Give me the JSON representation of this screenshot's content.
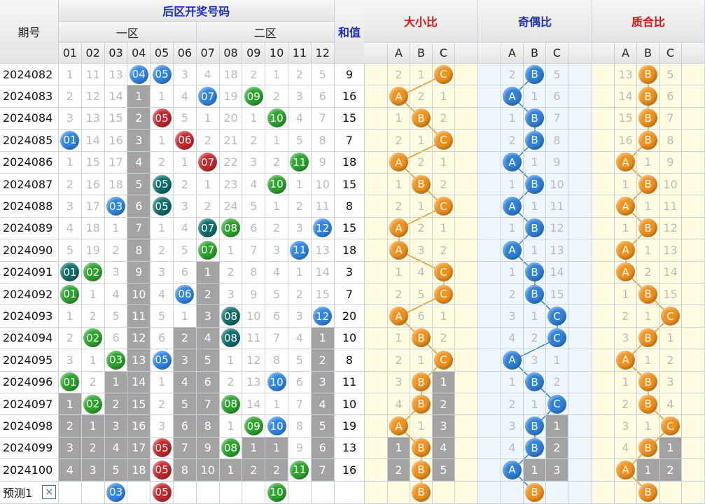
{
  "headers": {
    "issue": "期号",
    "back_area": "后区开奖号码",
    "zone1": "一区",
    "zone2": "二区",
    "sum": "和值",
    "size_ratio": "大小比",
    "parity_ratio": "奇偶比",
    "prime_ratio": "质合比",
    "numbers": [
      "01",
      "02",
      "03",
      "04",
      "05",
      "06",
      "07",
      "08",
      "09",
      "10",
      "11",
      "12"
    ],
    "abc": [
      "A",
      "B",
      "C"
    ]
  },
  "colors": {
    "blue": "#2e86e8",
    "red": "#c9262c",
    "green": "#2aa52a",
    "teal": "#0d6e6c",
    "orange": "#f2921c",
    "gray_fill": "#a3a3a3"
  },
  "rows": [
    {
      "issue": "2024082",
      "cells": [
        "1",
        "11",
        "13",
        "04",
        "05",
        "3",
        "4",
        "18",
        "2",
        "1",
        "2",
        "5"
      ],
      "sum": "9",
      "dx": [
        "2",
        "1",
        "C"
      ],
      "jo": [
        "2",
        "B",
        "5"
      ],
      "zh": [
        "13",
        "B",
        "5"
      ]
    },
    {
      "issue": "2024083",
      "cells": [
        "2",
        "12",
        "14",
        "1",
        "1",
        "4",
        "07",
        "19",
        "09",
        "2",
        "3",
        "6"
      ],
      "sum": "16",
      "dx": [
        "A",
        "2",
        "1"
      ],
      "jo": [
        "A",
        "1",
        "6"
      ],
      "zh": [
        "14",
        "B",
        "6"
      ]
    },
    {
      "issue": "2024084",
      "cells": [
        "3",
        "13",
        "15",
        "2",
        "05",
        "5",
        "1",
        "20",
        "1",
        "10",
        "4",
        "7"
      ],
      "sum": "15",
      "dx": [
        "1",
        "B",
        "2"
      ],
      "jo": [
        "1",
        "B",
        "7"
      ],
      "zh": [
        "15",
        "B",
        "7"
      ]
    },
    {
      "issue": "2024085",
      "cells": [
        "01",
        "14",
        "16",
        "3",
        "1",
        "06",
        "2",
        "21",
        "2",
        "1",
        "5",
        "8"
      ],
      "sum": "7",
      "dx": [
        "2",
        "1",
        "C"
      ],
      "jo": [
        "2",
        "B",
        "8"
      ],
      "zh": [
        "16",
        "B",
        "8"
      ]
    },
    {
      "issue": "2024086",
      "cells": [
        "1",
        "15",
        "17",
        "4",
        "2",
        "1",
        "07",
        "22",
        "3",
        "2",
        "11",
        "9"
      ],
      "sum": "18",
      "dx": [
        "A",
        "2",
        "1"
      ],
      "jo": [
        "A",
        "1",
        "9"
      ],
      "zh": [
        "A",
        "1",
        "9"
      ]
    },
    {
      "issue": "2024087",
      "cells": [
        "2",
        "16",
        "18",
        "5",
        "05",
        "2",
        "1",
        "23",
        "4",
        "10",
        "1",
        "10"
      ],
      "sum": "15",
      "dx": [
        "1",
        "B",
        "2"
      ],
      "jo": [
        "1",
        "B",
        "10"
      ],
      "zh": [
        "1",
        "B",
        "10"
      ]
    },
    {
      "issue": "2024088",
      "cells": [
        "3",
        "17",
        "03",
        "6",
        "05",
        "3",
        "2",
        "24",
        "5",
        "1",
        "2",
        "11"
      ],
      "sum": "8",
      "dx": [
        "2",
        "1",
        "C"
      ],
      "jo": [
        "A",
        "1",
        "11"
      ],
      "zh": [
        "A",
        "1",
        "11"
      ]
    },
    {
      "issue": "2024089",
      "cells": [
        "4",
        "18",
        "1",
        "7",
        "1",
        "4",
        "07",
        "08",
        "6",
        "2",
        "3",
        "12"
      ],
      "sum": "15",
      "dx": [
        "A",
        "2",
        "1"
      ],
      "jo": [
        "1",
        "B",
        "12"
      ],
      "zh": [
        "1",
        "B",
        "12"
      ]
    },
    {
      "issue": "2024090",
      "cells": [
        "5",
        "19",
        "2",
        "8",
        "2",
        "5",
        "07",
        "1",
        "7",
        "3",
        "11",
        "13"
      ],
      "sum": "18",
      "dx": [
        "A",
        "3",
        "2"
      ],
      "jo": [
        "A",
        "1",
        "13"
      ],
      "zh": [
        "A",
        "1",
        "13"
      ]
    },
    {
      "issue": "2024091",
      "cells": [
        "01",
        "02",
        "3",
        "9",
        "3",
        "6",
        "1",
        "2",
        "8",
        "4",
        "1",
        "14"
      ],
      "sum": "3",
      "dx": [
        "1",
        "4",
        "C"
      ],
      "jo": [
        "1",
        "B",
        "14"
      ],
      "zh": [
        "A",
        "2",
        "14"
      ]
    },
    {
      "issue": "2024092",
      "cells": [
        "01",
        "1",
        "4",
        "10",
        "4",
        "06",
        "2",
        "3",
        "9",
        "5",
        "2",
        "15"
      ],
      "sum": "7",
      "dx": [
        "2",
        "5",
        "C"
      ],
      "jo": [
        "2",
        "B",
        "15"
      ],
      "zh": [
        "1",
        "B",
        "15"
      ]
    },
    {
      "issue": "2024093",
      "cells": [
        "1",
        "2",
        "5",
        "11",
        "5",
        "1",
        "3",
        "08",
        "10",
        "6",
        "3",
        "12"
      ],
      "sum": "20",
      "dx": [
        "A",
        "6",
        "1"
      ],
      "jo": [
        "3",
        "1",
        "C"
      ],
      "zh": [
        "2",
        "1",
        "C"
      ]
    },
    {
      "issue": "2024094",
      "cells": [
        "2",
        "02",
        "6",
        "12",
        "6",
        "2",
        "4",
        "08",
        "11",
        "7",
        "4",
        "1"
      ],
      "sum": "10",
      "dx": [
        "1",
        "B",
        "2"
      ],
      "jo": [
        "4",
        "2",
        "C"
      ],
      "zh": [
        "3",
        "B",
        "1"
      ]
    },
    {
      "issue": "2024095",
      "cells": [
        "3",
        "1",
        "03",
        "13",
        "05",
        "3",
        "5",
        "1",
        "12",
        "8",
        "5",
        "2"
      ],
      "sum": "8",
      "dx": [
        "2",
        "1",
        "C"
      ],
      "jo": [
        "A",
        "3",
        "1"
      ],
      "zh": [
        "A",
        "1",
        "2"
      ]
    },
    {
      "issue": "2024096",
      "cells": [
        "01",
        "2",
        "1",
        "14",
        "1",
        "4",
        "6",
        "2",
        "13",
        "10",
        "6",
        "3"
      ],
      "sum": "11",
      "dx": [
        "3",
        "B",
        "1"
      ],
      "jo": [
        "1",
        "B",
        "2"
      ],
      "zh": [
        "1",
        "B",
        "3"
      ]
    },
    {
      "issue": "2024097",
      "cells": [
        "1",
        "02",
        "2",
        "15",
        "2",
        "5",
        "7",
        "08",
        "14",
        "1",
        "7",
        "4"
      ],
      "sum": "10",
      "dx": [
        "4",
        "B",
        "2"
      ],
      "jo": [
        "2",
        "1",
        "C"
      ],
      "zh": [
        "2",
        "B",
        "4"
      ]
    },
    {
      "issue": "2024098",
      "cells": [
        "2",
        "1",
        "3",
        "16",
        "3",
        "6",
        "8",
        "1",
        "09",
        "10",
        "8",
        "5"
      ],
      "sum": "19",
      "dx": [
        "A",
        "1",
        "3"
      ],
      "jo": [
        "3",
        "B",
        "1"
      ],
      "zh": [
        "3",
        "1",
        "C"
      ]
    },
    {
      "issue": "2024099",
      "cells": [
        "3",
        "2",
        "4",
        "17",
        "05",
        "7",
        "9",
        "08",
        "1",
        "1",
        "9",
        "6"
      ],
      "sum": "13",
      "dx": [
        "1",
        "B",
        "4"
      ],
      "jo": [
        "4",
        "B",
        "2"
      ],
      "zh": [
        "4",
        "B",
        "1"
      ]
    },
    {
      "issue": "2024100",
      "cells": [
        "4",
        "3",
        "5",
        "18",
        "05",
        "8",
        "10",
        "1",
        "2",
        "2",
        "11",
        "7"
      ],
      "sum": "16",
      "dx": [
        "2",
        "B",
        "5"
      ],
      "jo": [
        "A",
        "1",
        "3"
      ],
      "zh": [
        "A",
        "1",
        "2"
      ]
    }
  ],
  "predict": {
    "label": "预测1",
    "close_icon": "×",
    "cells": [
      "",
      "",
      "03",
      "",
      "05",
      "",
      "",
      "",
      "",
      "10",
      "",
      ""
    ],
    "dx": [
      "",
      "B",
      ""
    ],
    "jo": [
      "",
      "B",
      ""
    ],
    "zh": [
      "",
      "B",
      ""
    ]
  }
}
